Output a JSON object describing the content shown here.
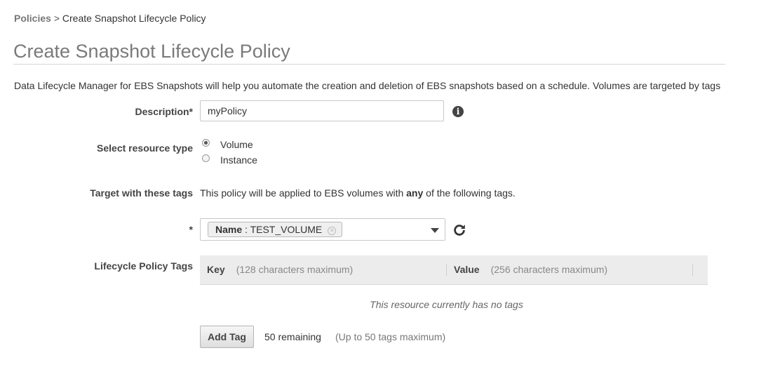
{
  "breadcrumb": {
    "parent": "Policies",
    "separator": ">",
    "current": "Create Snapshot Lifecycle Policy"
  },
  "page_title": "Create Snapshot Lifecycle Policy",
  "intro_text": "Data Lifecycle Manager for EBS Snapshots will help you automate the creation and deletion of EBS snapshots based on a schedule. Volumes are targeted by tags",
  "description": {
    "label": "Description*",
    "value": "myPolicy",
    "info_icon": "info-circle-icon"
  },
  "resource_type": {
    "label": "Select resource type",
    "options": [
      {
        "label": "Volume",
        "selected": true
      },
      {
        "label": "Instance",
        "selected": false
      }
    ]
  },
  "target_tags": {
    "label": "Target with these tags",
    "help_prefix": "This policy will be applied to EBS volumes with ",
    "help_emphasis": "any",
    "help_suffix": " of the following tags.",
    "required_marker": "*",
    "selected_tag": {
      "key": "Name",
      "separator": " : ",
      "value": "TEST_VOLUME"
    },
    "refresh_icon": "refresh-icon"
  },
  "lifecycle_tags": {
    "label": "Lifecycle Policy Tags",
    "columns": [
      {
        "name": "Key",
        "hint": "(128 characters maximum)"
      },
      {
        "name": "Value",
        "hint": "(256 characters maximum)"
      }
    ],
    "empty_text": "This resource currently has no tags",
    "add_button": "Add Tag",
    "remaining": "50 remaining",
    "max_note": "(Up to 50 tags maximum)"
  }
}
